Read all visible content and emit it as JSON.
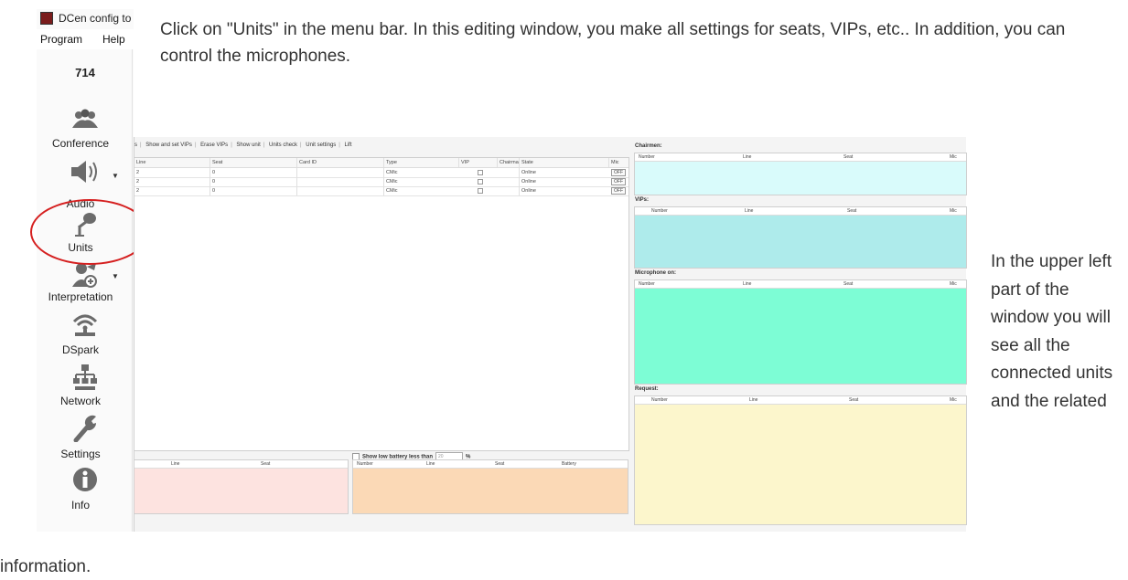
{
  "instructions": {
    "text_top": "Click on \"Units\" in the menu bar. In this editing window, you make all settings for seats, VIPs, etc.. In addition, you can control the microphones.",
    "text_right": "In the upper left part of the window you will see all the connected units and the related",
    "text_bottom": "information."
  },
  "app": {
    "title": "DCen config to",
    "menu": [
      "Program",
      "Help"
    ],
    "counter": "714"
  },
  "sidebar": {
    "items": [
      {
        "label": "Conference",
        "icon": "people-group-icon"
      },
      {
        "label": "Audio",
        "icon": "speaker-icon"
      },
      {
        "label": "Units",
        "icon": "microphone-icon"
      },
      {
        "label": "Interpretation",
        "icon": "interpreter-icon"
      },
      {
        "label": "DSpark",
        "icon": "wireless-icon"
      },
      {
        "label": "Network",
        "icon": "network-icon"
      },
      {
        "label": "Settings",
        "icon": "wrench-icon"
      },
      {
        "label": "Info",
        "icon": "info-icon"
      }
    ]
  },
  "toolbar": {
    "items": [
      "s",
      "Show and set VIPs",
      "Erase VIPs",
      "Show unit",
      "Units check",
      "Unit settings",
      "Lift"
    ]
  },
  "units_grid": {
    "columns": [
      "Line",
      "Seat",
      "Card ID",
      "Type",
      "VIP",
      "Chairman",
      "State",
      "Mic"
    ],
    "rows": [
      {
        "line": "2",
        "seat": "0",
        "card_id": "",
        "type": "CMic",
        "state": "Online",
        "mic": "OFF"
      },
      {
        "line": "2",
        "seat": "0",
        "card_id": "",
        "type": "CMic",
        "state": "Online",
        "mic": "OFF"
      },
      {
        "line": "2",
        "seat": "0",
        "card_id": "",
        "type": "CMic",
        "state": "Online",
        "mic": "OFF"
      }
    ]
  },
  "battery": {
    "checkbox_label": "Show low battery less than",
    "value": "20",
    "unit": "%",
    "columns": [
      "Number",
      "Line",
      "Seat",
      "Battery"
    ]
  },
  "left_bottom_panel": {
    "columns": [
      "Line",
      "Seat"
    ]
  },
  "right_panels": [
    {
      "title": "Chairmen:",
      "columns": [
        "Number",
        "Line",
        "Seat",
        "Mic"
      ],
      "color": "#d9fbfb"
    },
    {
      "title": "VIPs:",
      "columns": [
        "Number",
        "Line",
        "Seat",
        "Mic"
      ],
      "color": "#aeebeb"
    },
    {
      "title": "Microphone on:",
      "columns": [
        "Number",
        "Line",
        "Seat",
        "Mic"
      ],
      "color": "#7dfdd5"
    },
    {
      "title": "Request:",
      "columns": [
        "Number",
        "Line",
        "Seat",
        "Mic"
      ],
      "color": "#fcf6cc"
    }
  ],
  "colors": {
    "highlight": "#d51f1f",
    "pink_panel": "#fde3e0",
    "orange_panel": "#fbd9b6"
  }
}
